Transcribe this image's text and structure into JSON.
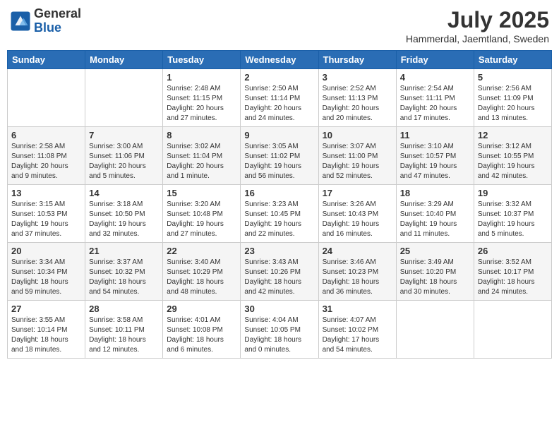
{
  "header": {
    "logo_general": "General",
    "logo_blue": "Blue",
    "month_title": "July 2025",
    "location": "Hammerdal, Jaemtland, Sweden"
  },
  "weekdays": [
    "Sunday",
    "Monday",
    "Tuesday",
    "Wednesday",
    "Thursday",
    "Friday",
    "Saturday"
  ],
  "weeks": [
    [
      {
        "day": "",
        "info": ""
      },
      {
        "day": "",
        "info": ""
      },
      {
        "day": "1",
        "info": "Sunrise: 2:48 AM\nSunset: 11:15 PM\nDaylight: 20 hours\nand 27 minutes."
      },
      {
        "day": "2",
        "info": "Sunrise: 2:50 AM\nSunset: 11:14 PM\nDaylight: 20 hours\nand 24 minutes."
      },
      {
        "day": "3",
        "info": "Sunrise: 2:52 AM\nSunset: 11:13 PM\nDaylight: 20 hours\nand 20 minutes."
      },
      {
        "day": "4",
        "info": "Sunrise: 2:54 AM\nSunset: 11:11 PM\nDaylight: 20 hours\nand 17 minutes."
      },
      {
        "day": "5",
        "info": "Sunrise: 2:56 AM\nSunset: 11:09 PM\nDaylight: 20 hours\nand 13 minutes."
      }
    ],
    [
      {
        "day": "6",
        "info": "Sunrise: 2:58 AM\nSunset: 11:08 PM\nDaylight: 20 hours\nand 9 minutes."
      },
      {
        "day": "7",
        "info": "Sunrise: 3:00 AM\nSunset: 11:06 PM\nDaylight: 20 hours\nand 5 minutes."
      },
      {
        "day": "8",
        "info": "Sunrise: 3:02 AM\nSunset: 11:04 PM\nDaylight: 20 hours\nand 1 minute."
      },
      {
        "day": "9",
        "info": "Sunrise: 3:05 AM\nSunset: 11:02 PM\nDaylight: 19 hours\nand 56 minutes."
      },
      {
        "day": "10",
        "info": "Sunrise: 3:07 AM\nSunset: 11:00 PM\nDaylight: 19 hours\nand 52 minutes."
      },
      {
        "day": "11",
        "info": "Sunrise: 3:10 AM\nSunset: 10:57 PM\nDaylight: 19 hours\nand 47 minutes."
      },
      {
        "day": "12",
        "info": "Sunrise: 3:12 AM\nSunset: 10:55 PM\nDaylight: 19 hours\nand 42 minutes."
      }
    ],
    [
      {
        "day": "13",
        "info": "Sunrise: 3:15 AM\nSunset: 10:53 PM\nDaylight: 19 hours\nand 37 minutes."
      },
      {
        "day": "14",
        "info": "Sunrise: 3:18 AM\nSunset: 10:50 PM\nDaylight: 19 hours\nand 32 minutes."
      },
      {
        "day": "15",
        "info": "Sunrise: 3:20 AM\nSunset: 10:48 PM\nDaylight: 19 hours\nand 27 minutes."
      },
      {
        "day": "16",
        "info": "Sunrise: 3:23 AM\nSunset: 10:45 PM\nDaylight: 19 hours\nand 22 minutes."
      },
      {
        "day": "17",
        "info": "Sunrise: 3:26 AM\nSunset: 10:43 PM\nDaylight: 19 hours\nand 16 minutes."
      },
      {
        "day": "18",
        "info": "Sunrise: 3:29 AM\nSunset: 10:40 PM\nDaylight: 19 hours\nand 11 minutes."
      },
      {
        "day": "19",
        "info": "Sunrise: 3:32 AM\nSunset: 10:37 PM\nDaylight: 19 hours\nand 5 minutes."
      }
    ],
    [
      {
        "day": "20",
        "info": "Sunrise: 3:34 AM\nSunset: 10:34 PM\nDaylight: 18 hours\nand 59 minutes."
      },
      {
        "day": "21",
        "info": "Sunrise: 3:37 AM\nSunset: 10:32 PM\nDaylight: 18 hours\nand 54 minutes."
      },
      {
        "day": "22",
        "info": "Sunrise: 3:40 AM\nSunset: 10:29 PM\nDaylight: 18 hours\nand 48 minutes."
      },
      {
        "day": "23",
        "info": "Sunrise: 3:43 AM\nSunset: 10:26 PM\nDaylight: 18 hours\nand 42 minutes."
      },
      {
        "day": "24",
        "info": "Sunrise: 3:46 AM\nSunset: 10:23 PM\nDaylight: 18 hours\nand 36 minutes."
      },
      {
        "day": "25",
        "info": "Sunrise: 3:49 AM\nSunset: 10:20 PM\nDaylight: 18 hours\nand 30 minutes."
      },
      {
        "day": "26",
        "info": "Sunrise: 3:52 AM\nSunset: 10:17 PM\nDaylight: 18 hours\nand 24 minutes."
      }
    ],
    [
      {
        "day": "27",
        "info": "Sunrise: 3:55 AM\nSunset: 10:14 PM\nDaylight: 18 hours\nand 18 minutes."
      },
      {
        "day": "28",
        "info": "Sunrise: 3:58 AM\nSunset: 10:11 PM\nDaylight: 18 hours\nand 12 minutes."
      },
      {
        "day": "29",
        "info": "Sunrise: 4:01 AM\nSunset: 10:08 PM\nDaylight: 18 hours\nand 6 minutes."
      },
      {
        "day": "30",
        "info": "Sunrise: 4:04 AM\nSunset: 10:05 PM\nDaylight: 18 hours\nand 0 minutes."
      },
      {
        "day": "31",
        "info": "Sunrise: 4:07 AM\nSunset: 10:02 PM\nDaylight: 17 hours\nand 54 minutes."
      },
      {
        "day": "",
        "info": ""
      },
      {
        "day": "",
        "info": ""
      }
    ]
  ]
}
